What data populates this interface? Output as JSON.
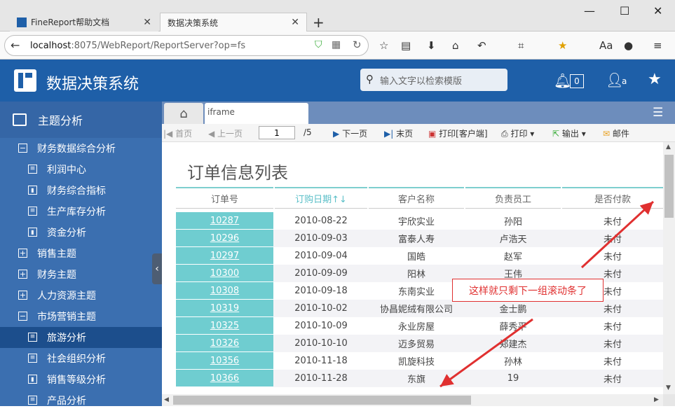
{
  "browser": {
    "tabs": [
      {
        "title": "FineReport帮助文档"
      },
      {
        "title": "数据决策系统"
      }
    ],
    "url_host": "localhost",
    "url_rest": ":8075/WebReport/ReportServer?op=fs",
    "window_controls": {
      "minimize": "—",
      "maximize": "☐",
      "close": "✕"
    }
  },
  "app": {
    "title": "数据决策系统",
    "search_placeholder": "输入文字以检索模版",
    "notification_count": "0",
    "user_label": "a"
  },
  "sidebar": {
    "header": "主题分析",
    "items": [
      {
        "label": "财务数据综合分析",
        "type": "group-open"
      },
      {
        "label": "利润中心",
        "type": "report"
      },
      {
        "label": "财务综合指标",
        "type": "chart"
      },
      {
        "label": "生产库存分析",
        "type": "report"
      },
      {
        "label": "资金分析",
        "type": "chart"
      },
      {
        "label": "销售主题",
        "type": "group-closed"
      },
      {
        "label": "财务主题",
        "type": "group-closed"
      },
      {
        "label": "人力资源主题",
        "type": "group-closed"
      },
      {
        "label": "市场营销主题",
        "type": "group-open"
      },
      {
        "label": "旅游分析",
        "type": "report",
        "selected": true
      },
      {
        "label": "社会组织分析",
        "type": "report"
      },
      {
        "label": "销售等级分析",
        "type": "chart"
      },
      {
        "label": "产品分析",
        "type": "report"
      }
    ]
  },
  "content_tabs": {
    "iframe_label": "iframe"
  },
  "toolbar": {
    "first": "首页",
    "prev": "上一页",
    "page_value": "1",
    "page_total": "/5",
    "next": "下一页",
    "last": "末页",
    "print_client": "打印[客户端]",
    "print": "打印",
    "export": "输出",
    "mail": "邮件"
  },
  "report": {
    "title": "订单信息列表",
    "columns": [
      "订单号",
      "订购日期↑↓",
      "客户名称",
      "负责员工",
      "是否付款"
    ],
    "rows": [
      [
        "10287",
        "2010-08-22",
        "宇欣实业",
        "孙阳",
        "未付"
      ],
      [
        "10296",
        "2010-09-03",
        "富泰人寿",
        "卢浩天",
        "未付"
      ],
      [
        "10297",
        "2010-09-04",
        "国皓",
        "赵军",
        "未付"
      ],
      [
        "10300",
        "2010-09-09",
        "阳林",
        "王伟",
        "未付"
      ],
      [
        "10308",
        "2010-09-18",
        "东南实业",
        "",
        "未付"
      ],
      [
        "10319",
        "2010-10-02",
        "协昌妮绒有限公司",
        "金士鹏",
        "未付"
      ],
      [
        "10325",
        "2010-10-09",
        "永业房屋",
        "薛秀平",
        "未付"
      ],
      [
        "10326",
        "2010-10-10",
        "迈多贸易",
        "郑建杰",
        "未付"
      ],
      [
        "10356",
        "2010-11-18",
        "凯旋科技",
        "孙林",
        "未付"
      ],
      [
        "10366",
        "2010-11-28",
        "东旗",
        "19",
        "未付"
      ]
    ]
  },
  "annotation": {
    "text": "这样就只剩下一组滚动条了"
  },
  "colors": {
    "header_blue": "#1e5fa8",
    "sidebar_blue": "#3b6fb0",
    "teal": "#6fcdd0",
    "annotation_red": "#e03030"
  }
}
